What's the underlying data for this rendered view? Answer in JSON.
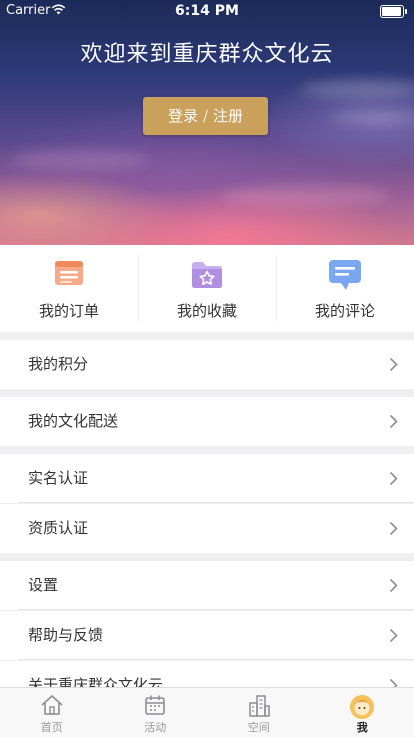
{
  "status_bar": {
    "carrier": "Carrier",
    "time": "6:14 PM"
  },
  "hero": {
    "welcome": "欢迎来到重庆群众文化云",
    "login": "登录",
    "separator": "/",
    "register": "注册"
  },
  "quick_actions": [
    {
      "label": "我的订单",
      "icon": "order-list-icon",
      "color": "#f08a5d"
    },
    {
      "label": "我的收藏",
      "icon": "favorite-star-folder-icon",
      "color": "#b08ee0"
    },
    {
      "label": "我的评论",
      "icon": "comment-bubble-icon",
      "color": "#6e9ef0"
    }
  ],
  "menu": [
    {
      "label": "我的积分"
    },
    {
      "label": "我的文化配送"
    },
    {
      "label": "实名认证"
    },
    {
      "label": "资质认证"
    },
    {
      "label": "设置"
    },
    {
      "label": "帮助与反馈"
    },
    {
      "label": "关于重庆群众文化云"
    }
  ],
  "tabbar": [
    {
      "label": "首页",
      "icon": "home-icon",
      "active": false
    },
    {
      "label": "活动",
      "icon": "calendar-icon",
      "active": false
    },
    {
      "label": "空间",
      "icon": "buildings-icon",
      "active": false
    },
    {
      "label": "我",
      "icon": "user-avatar-icon",
      "active": true
    }
  ],
  "colors": {
    "accent": "#c9a15a",
    "background": "#efeff1"
  }
}
